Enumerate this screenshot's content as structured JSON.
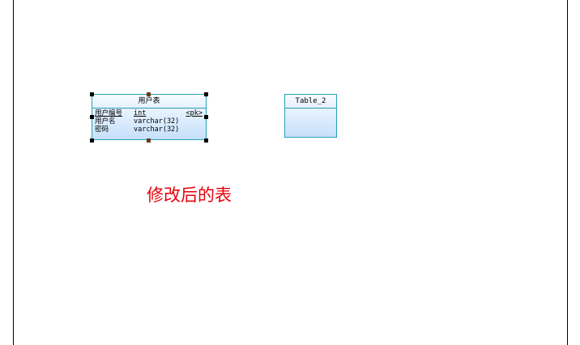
{
  "diagram": {
    "tables": [
      {
        "name": "用户表",
        "columns": [
          {
            "name": "用户编号",
            "type": "int",
            "key": "<pk>"
          },
          {
            "name": "用户名",
            "type": "varchar(32)",
            "key": ""
          },
          {
            "name": "密码",
            "type": "varchar(32)",
            "key": ""
          }
        ]
      },
      {
        "name": "Table_2",
        "columns": []
      }
    ],
    "annotation": "修改后的表",
    "colors": {
      "entity_border": "#2aa0b8",
      "entity_fill_top": "#f3f9ff",
      "entity_fill_bottom": "#c6e0fb",
      "annotation_text": "#e8000b",
      "page_border": "#000000"
    }
  }
}
